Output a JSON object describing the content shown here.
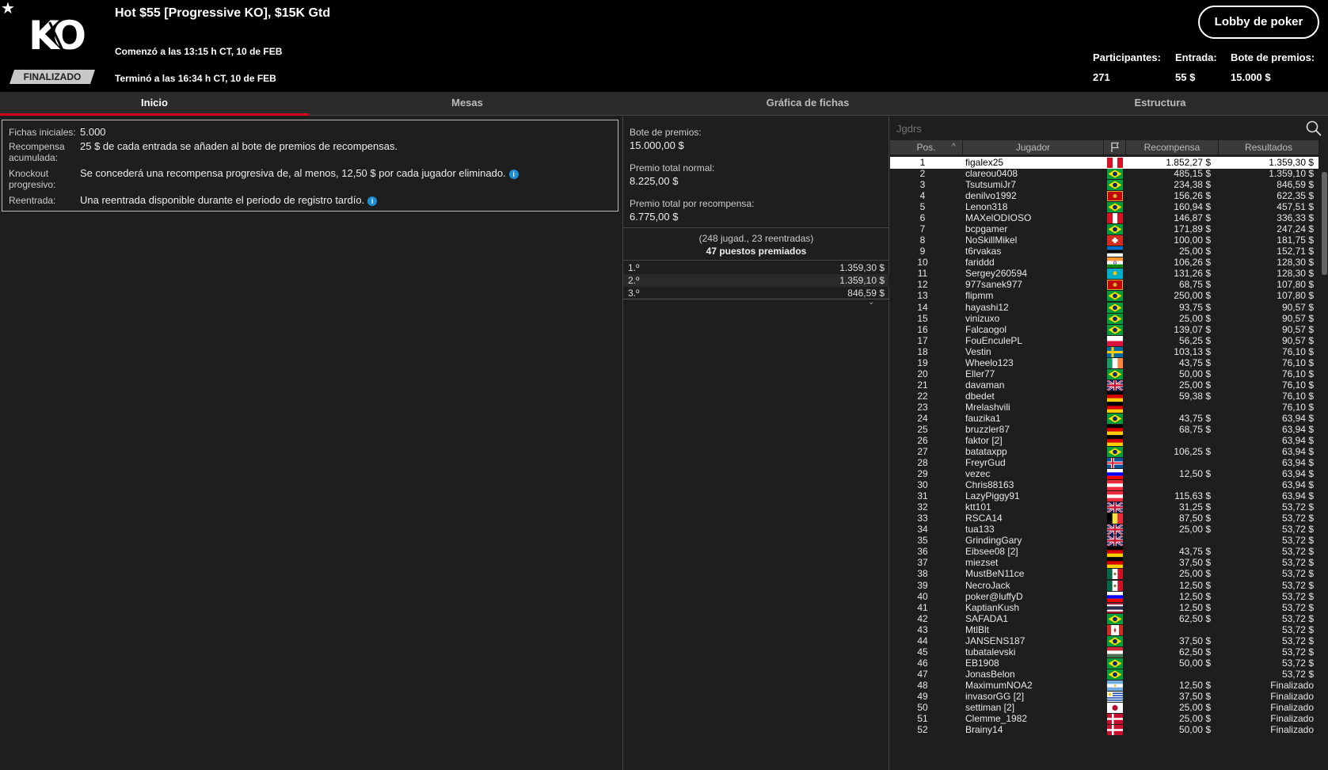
{
  "header": {
    "title": "Hot $55 [Progressive KO], $15K Gtd",
    "logo_text": "KO",
    "status": "FINALIZADO",
    "started": "Comenzó a las 13:15 h CT, 10 de FEB",
    "ended": "Terminó a las 16:34 h CT, 10 de FEB",
    "lobby_button": "Lobby de poker",
    "stats": [
      {
        "label": "Participantes:",
        "value": "271"
      },
      {
        "label": "Entrada:",
        "value": "55 $"
      },
      {
        "label": "Bote de premios:",
        "value": "15.000 $"
      }
    ],
    "favorite_icon": "star-icon"
  },
  "tabs": [
    {
      "label": "Inicio",
      "active": true
    },
    {
      "label": "Mesas",
      "active": false
    },
    {
      "label": "Gráfica de fichas",
      "active": false
    },
    {
      "label": "Estructura",
      "active": false
    }
  ],
  "info": [
    {
      "label": "Fichas iniciales:",
      "value": "5.000"
    },
    {
      "label": "Recompensa acumulada:",
      "value": "25 $ de cada entrada se añaden al bote de premios de recompensas."
    },
    {
      "label": "Knockout progresivo:",
      "value": "Se concederá una recompensa progresiva de, al menos, 12,50 $ por cada jugador eliminado."
    },
    {
      "label": "Reentrada:",
      "value": "Una reentrada disponible durante el periodo de registro tardío."
    }
  ],
  "prizes": {
    "pool_label": "Bote de premios:",
    "pool_value": "15.000,00 $",
    "normal_label": "Premio total normal:",
    "normal_value": "8.225,00 $",
    "bounty_label": "Premio total por recompensa:",
    "bounty_value": "6.775,00 $",
    "entrants_note": "(248 jugad., 23 reentradas)",
    "paid_places": "47 puestos premiados",
    "payouts": [
      {
        "place": "1.º",
        "amount": "1.359,30 $"
      },
      {
        "place": "2.º",
        "amount": "1.359,10 $"
      },
      {
        "place": "3.º",
        "amount": "846,59 $"
      }
    ]
  },
  "players": {
    "search_placeholder": "Jgdrs",
    "columns": {
      "pos": "Pos.",
      "player": "Jugador",
      "bounty": "Recompensa",
      "result": "Resultados"
    },
    "rows": [
      {
        "pos": "1",
        "name": "figalex25",
        "flag": "peru",
        "bounty": "1.852,27 $",
        "result": "1.359,30 $"
      },
      {
        "pos": "2",
        "name": "clareou0408",
        "flag": "brazil",
        "bounty": "485,15 $",
        "result": "1.359,10 $"
      },
      {
        "pos": "3",
        "name": "TsutsumiJr7",
        "flag": "brazil",
        "bounty": "234,38 $",
        "result": "846,59 $"
      },
      {
        "pos": "4",
        "name": "denilvo1992",
        "flag": "montenegro",
        "bounty": "156,26 $",
        "result": "622,35 $"
      },
      {
        "pos": "5",
        "name": "Lenon318",
        "flag": "brazil",
        "bounty": "160,94 $",
        "result": "457,51 $"
      },
      {
        "pos": "6",
        "name": "MAXelODIOSO",
        "flag": "peru",
        "bounty": "146,87 $",
        "result": "336,33 $"
      },
      {
        "pos": "7",
        "name": "bcpgamer",
        "flag": "brazil",
        "bounty": "171,89 $",
        "result": "247,24 $"
      },
      {
        "pos": "8",
        "name": "NoSkillMikel",
        "flag": "switzerland",
        "bounty": "100,00 $",
        "result": "181,75 $"
      },
      {
        "pos": "9",
        "name": "t6rvakas",
        "flag": "estonia",
        "bounty": "25,00 $",
        "result": "152,71 $"
      },
      {
        "pos": "10",
        "name": "fariddd",
        "flag": "india",
        "bounty": "106,26 $",
        "result": "128,30 $"
      },
      {
        "pos": "11",
        "name": "Sergey260594",
        "flag": "kazakhstan",
        "bounty": "131,26 $",
        "result": "128,30 $"
      },
      {
        "pos": "12",
        "name": "977sanek977",
        "flag": "montenegro",
        "bounty": "68,75 $",
        "result": "107,80 $"
      },
      {
        "pos": "13",
        "name": "flipmm",
        "flag": "brazil",
        "bounty": "250,00 $",
        "result": "107,80 $"
      },
      {
        "pos": "14",
        "name": "hayashi12",
        "flag": "brazil",
        "bounty": "93,75 $",
        "result": "90,57 $"
      },
      {
        "pos": "15",
        "name": "vinizuxo",
        "flag": "brazil",
        "bounty": "25,00 $",
        "result": "90,57 $"
      },
      {
        "pos": "16",
        "name": "Falcaogol",
        "flag": "brazil",
        "bounty": "139,07 $",
        "result": "90,57 $"
      },
      {
        "pos": "17",
        "name": "FouEnculePL",
        "flag": "poland",
        "bounty": "56,25 $",
        "result": "90,57 $"
      },
      {
        "pos": "18",
        "name": "Vestin",
        "flag": "sweden",
        "bounty": "103,13 $",
        "result": "76,10 $"
      },
      {
        "pos": "19",
        "name": "Wheelo123",
        "flag": "ireland",
        "bounty": "43,75 $",
        "result": "76,10 $"
      },
      {
        "pos": "20",
        "name": "Eller77",
        "flag": "brazil",
        "bounty": "50,00 $",
        "result": "76,10 $"
      },
      {
        "pos": "21",
        "name": "davaman",
        "flag": "uk",
        "bounty": "25,00 $",
        "result": "76,10 $"
      },
      {
        "pos": "22",
        "name": "dbedet",
        "flag": "germany",
        "bounty": "59,38 $",
        "result": "76,10 $"
      },
      {
        "pos": "23",
        "name": "Mrelashvili",
        "flag": "germany",
        "bounty": "",
        "result": "76,10 $"
      },
      {
        "pos": "24",
        "name": "fauzika1",
        "flag": "brazil",
        "bounty": "43,75 $",
        "result": "63,94 $"
      },
      {
        "pos": "25",
        "name": "bruzzler87",
        "flag": "germany",
        "bounty": "68,75 $",
        "result": "63,94 $"
      },
      {
        "pos": "26",
        "name": "faktor [2]",
        "flag": "germany",
        "bounty": "",
        "result": "63,94 $"
      },
      {
        "pos": "27",
        "name": "batataxpp",
        "flag": "brazil",
        "bounty": "106,25 $",
        "result": "63,94 $"
      },
      {
        "pos": "28",
        "name": "FreyrGud",
        "flag": "iceland",
        "bounty": "",
        "result": "63,94 $"
      },
      {
        "pos": "29",
        "name": "vezec",
        "flag": "slovenia",
        "bounty": "12,50 $",
        "result": "63,94 $"
      },
      {
        "pos": "30",
        "name": "Chris88163",
        "flag": "austria",
        "bounty": "",
        "result": "63,94 $"
      },
      {
        "pos": "31",
        "name": "LazyPiggy91",
        "flag": "austria",
        "bounty": "115,63 $",
        "result": "63,94 $"
      },
      {
        "pos": "32",
        "name": "ktt101",
        "flag": "uk",
        "bounty": "31,25 $",
        "result": "53,72 $"
      },
      {
        "pos": "33",
        "name": "RSCA14",
        "flag": "belgium",
        "bounty": "87,50 $",
        "result": "53,72 $"
      },
      {
        "pos": "34",
        "name": "tua133",
        "flag": "uk",
        "bounty": "25,00 $",
        "result": "53,72 $"
      },
      {
        "pos": "35",
        "name": "GrindingGary",
        "flag": "uk",
        "bounty": "",
        "result": "53,72 $"
      },
      {
        "pos": "36",
        "name": "Eibsee08 [2]",
        "flag": "germany",
        "bounty": "43,75 $",
        "result": "53,72 $"
      },
      {
        "pos": "37",
        "name": "miezset",
        "flag": "germany",
        "bounty": "37,50 $",
        "result": "53,72 $"
      },
      {
        "pos": "38",
        "name": "MustBeN11ce",
        "flag": "mexico",
        "bounty": "25,00 $",
        "result": "53,72 $"
      },
      {
        "pos": "39",
        "name": "NecroJack",
        "flag": "mexico",
        "bounty": "12,50 $",
        "result": "53,72 $"
      },
      {
        "pos": "40",
        "name": "poker@luffyD",
        "flag": "slovenia",
        "bounty": "12,50 $",
        "result": "53,72 $"
      },
      {
        "pos": "41",
        "name": "KaptianKush",
        "flag": "thailand",
        "bounty": "12,50 $",
        "result": "53,72 $"
      },
      {
        "pos": "42",
        "name": "SAFADA1",
        "flag": "brazil",
        "bounty": "62,50 $",
        "result": "53,72 $"
      },
      {
        "pos": "43",
        "name": "MtlBlt",
        "flag": "canada",
        "bounty": "",
        "result": "53,72 $"
      },
      {
        "pos": "44",
        "name": "JANSENS187",
        "flag": "brazil",
        "bounty": "37,50 $",
        "result": "53,72 $"
      },
      {
        "pos": "45",
        "name": "tubatalevski",
        "flag": "hungary",
        "bounty": "62,50 $",
        "result": "53,72 $"
      },
      {
        "pos": "46",
        "name": "EB1908",
        "flag": "brazil",
        "bounty": "50,00 $",
        "result": "53,72 $"
      },
      {
        "pos": "47",
        "name": "JonasBelon",
        "flag": "brazil",
        "bounty": "",
        "result": "53,72 $"
      },
      {
        "pos": "48",
        "name": "MaximumNOA2",
        "flag": "argentina",
        "bounty": "12,50 $",
        "result": "Finalizado"
      },
      {
        "pos": "49",
        "name": "invasorGG [2]",
        "flag": "uruguay",
        "bounty": "37,50 $",
        "result": "Finalizado"
      },
      {
        "pos": "50",
        "name": "settiman [2]",
        "flag": "japan",
        "bounty": "25,00 $",
        "result": "Finalizado"
      },
      {
        "pos": "51",
        "name": "Clemme_1982",
        "flag": "denmark",
        "bounty": "25,00 $",
        "result": "Finalizado"
      },
      {
        "pos": "52",
        "name": "Brainy14",
        "flag": "denmark",
        "bounty": "50,00 $",
        "result": "Finalizado"
      }
    ]
  },
  "colors": {
    "accent": "#d0021b",
    "header_bg": "#000000",
    "panel_bg": "#1e1e1e",
    "selected_row": "#ffffff",
    "info_icon": "#1d8fd6"
  }
}
